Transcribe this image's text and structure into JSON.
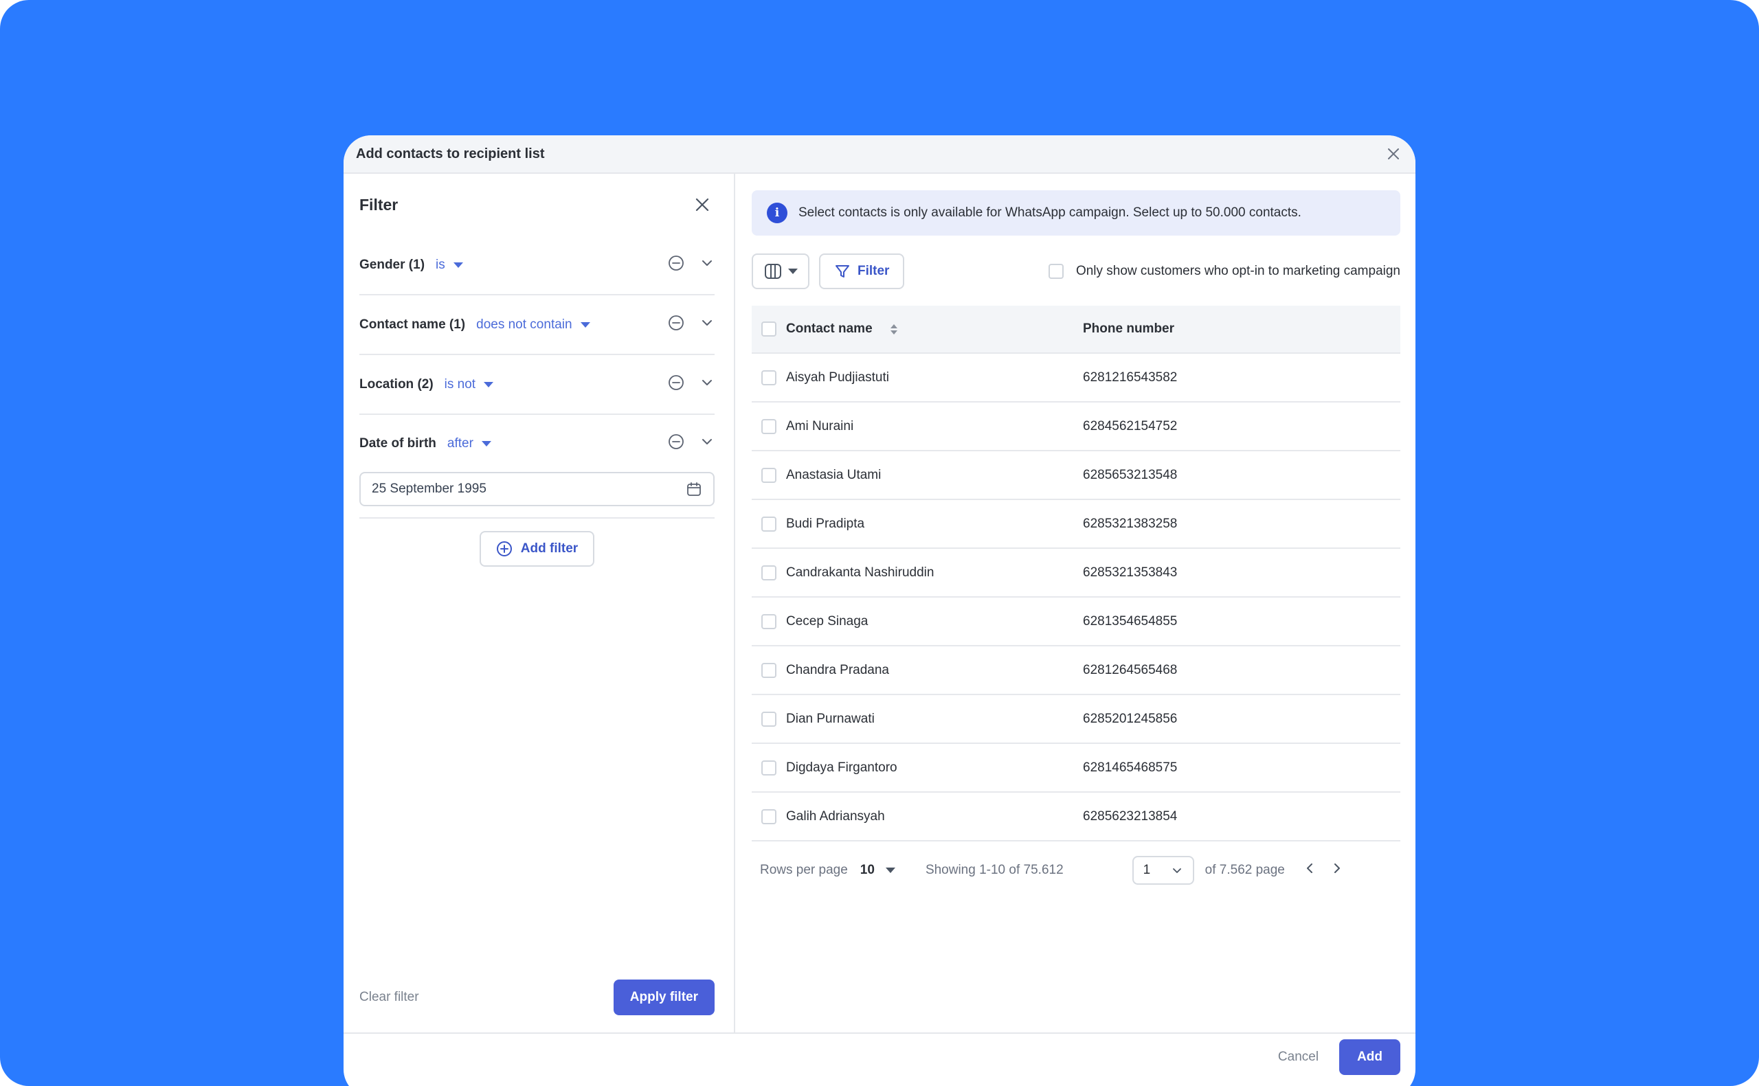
{
  "modal": {
    "title": "Add contacts to recipient list"
  },
  "filter_panel": {
    "title": "Filter",
    "filters": [
      {
        "label": "Gender (1)",
        "operator": "is"
      },
      {
        "label": "Contact name (1)",
        "operator": "does not contain"
      },
      {
        "label": "Location (2)",
        "operator": "is not"
      },
      {
        "label": "Date of birth",
        "operator": "after",
        "value": "25 September 1995"
      }
    ],
    "add_filter_label": "Add filter",
    "clear_filter_label": "Clear filter",
    "apply_filter_label": "Apply filter"
  },
  "main": {
    "info_icon": "i",
    "info_text": "Select contacts is only available for WhatsApp campaign. Select up to 50.000 contacts.",
    "filter_button_label": "Filter",
    "optin_label": "Only show customers who opt-in to marketing campaign",
    "table": {
      "headers": [
        "Contact name",
        "Phone number"
      ],
      "rows": [
        {
          "name": "Aisyah Pudjiastuti",
          "phone": "6281216543582"
        },
        {
          "name": "Ami Nuraini",
          "phone": "6284562154752"
        },
        {
          "name": "Anastasia Utami",
          "phone": "6285653213548"
        },
        {
          "name": "Budi Pradipta",
          "phone": "6285321383258"
        },
        {
          "name": "Candrakanta Nashiruddin",
          "phone": "6285321353843"
        },
        {
          "name": "Cecep Sinaga",
          "phone": "6281354654855"
        },
        {
          "name": "Chandra Pradana",
          "phone": "6281264565468"
        },
        {
          "name": "Dian Purnawati",
          "phone": "6285201245856"
        },
        {
          "name": "Digdaya Firgantoro",
          "phone": "6281465468575"
        },
        {
          "name": "Galih Adriansyah",
          "phone": "6285623213854"
        }
      ]
    },
    "pagination": {
      "rows_per_page_label": "Rows per page",
      "rows_per_page_value": "10",
      "showing_text": "Showing 1-10 of 75.612",
      "current_page": "1",
      "of_pages_text": "of 7.562 page"
    }
  },
  "footer": {
    "cancel_label": "Cancel",
    "add_label": "Add"
  },
  "colors": {
    "background": "#2a7bff",
    "accent": "#4a5fd9",
    "link": "#4b6bd9"
  }
}
